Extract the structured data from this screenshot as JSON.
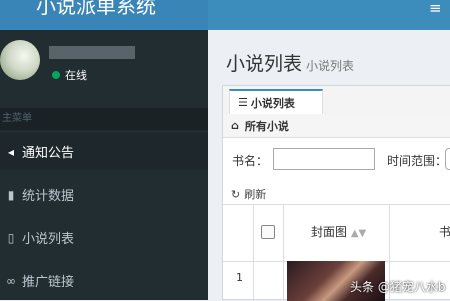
{
  "header": {
    "brand": "小说派单系统",
    "menu_icon": "hamburger-icon"
  },
  "sidebar": {
    "user_status": "在线",
    "status_color": "#00a65a",
    "menu_header": "主菜单",
    "items": [
      {
        "label": "通知公告",
        "icon": "volume-icon"
      },
      {
        "label": "统计数据",
        "icon": "bar-chart-icon"
      },
      {
        "label": "小说列表",
        "icon": "book-icon"
      },
      {
        "label": "推广链接",
        "icon": "link-icon"
      }
    ]
  },
  "content": {
    "title": "小说列表",
    "subtitle": "小说列表",
    "tab": "小说列表",
    "panel_title": "所有小说",
    "filters": {
      "name_label": "书名：",
      "name_value": "",
      "date_label": "时间范围："
    },
    "refresh": "刷新",
    "table": {
      "columns": [
        "封面图",
        "书"
      ],
      "rows": [
        {
          "num": "1"
        }
      ]
    }
  },
  "watermark": "头条 @猪宠八水b",
  "colors": {
    "header": "#3c8dbc",
    "sidebar": "#222d32",
    "accent": "#3c8dbc"
  }
}
